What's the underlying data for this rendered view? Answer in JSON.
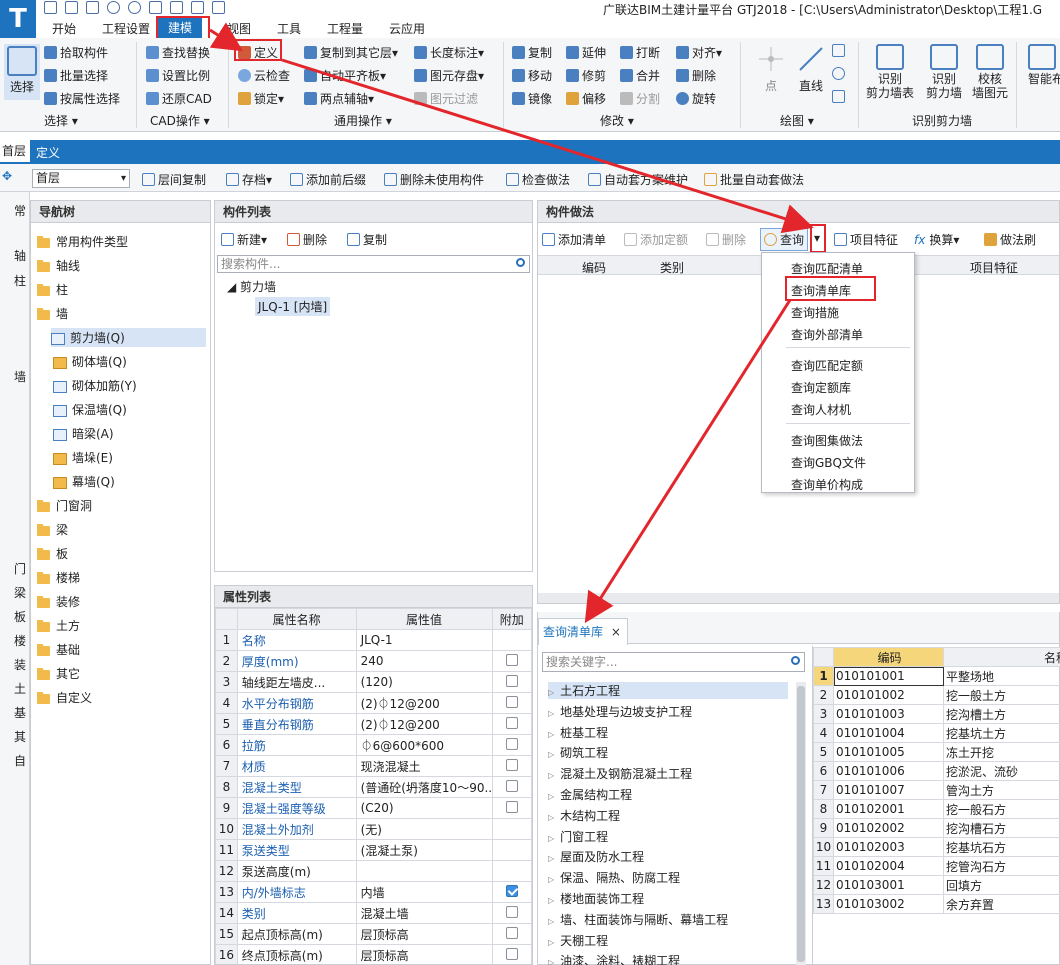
{
  "app": {
    "title": "广联达BIM土建计量平台 GTJ2018 - [C:\\Users\\Administrator\\Desktop\\工程1.G",
    "logo": "T"
  },
  "menu": [
    "开始",
    "工程设置",
    "建模",
    "视图",
    "工具",
    "工程量",
    "云应用"
  ],
  "ribbon": {
    "select_big": "选择",
    "select_items": [
      "拾取构件",
      "批量选择",
      "按属性选择"
    ],
    "select_group": "选择",
    "cad_items": [
      "查找替换",
      "设置比例",
      "还原CAD"
    ],
    "cad_group": "CAD操作",
    "define": "定义",
    "cloud_check": "云检查",
    "lock": "锁定",
    "common_items": [
      "复制到其它层",
      "自动平齐板",
      "两点辅轴"
    ],
    "common_items2": [
      "长度标注",
      "图元存盘",
      "图元过滤"
    ],
    "common_group": "通用操作",
    "modify_items": [
      "复制",
      "移动",
      "镜像",
      "延伸",
      "修剪",
      "偏移",
      "打断",
      "合并",
      "分割",
      "对齐",
      "删除",
      "旋转"
    ],
    "modify_group": "修改",
    "draw_items": [
      "点",
      "直线"
    ],
    "draw_group": "绘图",
    "recog_items": [
      "识别\n剪力墙表",
      "识别\n剪力墙",
      "校核\n墙图元",
      "智能布"
    ],
    "recog_group": "识别剪力墙"
  },
  "tabs": {
    "floor": "首层",
    "define": "定义"
  },
  "toolbar2": {
    "floor_select": "首层",
    "items": [
      "层间复制",
      "存档",
      "添加前后缀",
      "删除未使用构件",
      "检查做法",
      "自动套方案维护",
      "批量自动套做法"
    ]
  },
  "leftstrip": [
    "常",
    "轴",
    "柱",
    "墙",
    "门",
    "梁",
    "板",
    "楼",
    "装",
    "土",
    "基",
    "其",
    "自"
  ],
  "nav": {
    "title": "导航树",
    "items": [
      "常用构件类型",
      "轴线",
      "柱",
      "墙",
      "剪力墙(Q)",
      "砌体墙(Q)",
      "砌体加筋(Y)",
      "保温墙(Q)",
      "暗梁(A)",
      "墙垛(E)",
      "幕墙(Q)",
      "门窗洞",
      "梁",
      "板",
      "楼梯",
      "装修",
      "土方",
      "基础",
      "其它",
      "自定义"
    ]
  },
  "complist": {
    "title": "构件列表",
    "new": "新建",
    "delete": "删除",
    "copy": "复制",
    "search_placeholder": "搜索构件...",
    "group": "剪力墙",
    "item": "JLQ-1 [内墙]"
  },
  "props": {
    "title": "属性列表",
    "headers": [
      "属性名称",
      "属性值",
      "附加"
    ],
    "rows": [
      {
        "n": "1",
        "name": "名称",
        "value": "JLQ-1",
        "blue": true,
        "chk": null
      },
      {
        "n": "2",
        "name": "厚度(mm)",
        "value": "240",
        "blue": true,
        "chk": false
      },
      {
        "n": "3",
        "name": "轴线距左墙皮...",
        "value": "(120)",
        "blue": false,
        "chk": false
      },
      {
        "n": "4",
        "name": "水平分布钢筋",
        "value": "(2)⏀12@200",
        "blue": true,
        "chk": false
      },
      {
        "n": "5",
        "name": "垂直分布钢筋",
        "value": "(2)⏀12@200",
        "blue": true,
        "chk": false
      },
      {
        "n": "6",
        "name": "拉筋",
        "value": "⏀6@600*600",
        "blue": true,
        "chk": false
      },
      {
        "n": "7",
        "name": "材质",
        "value": "现浇混凝土",
        "blue": true,
        "chk": false
      },
      {
        "n": "8",
        "name": "混凝土类型",
        "value": "(普通砼(坍落度10～90...",
        "blue": true,
        "chk": false
      },
      {
        "n": "9",
        "name": "混凝土强度等级",
        "value": "(C20)",
        "blue": true,
        "chk": false
      },
      {
        "n": "10",
        "name": "混凝土外加剂",
        "value": "(无)",
        "blue": true,
        "chk": null
      },
      {
        "n": "11",
        "name": "泵送类型",
        "value": "(混凝土泵)",
        "blue": true,
        "chk": null
      },
      {
        "n": "12",
        "name": "泵送高度(m)",
        "value": "",
        "blue": false,
        "chk": null
      },
      {
        "n": "13",
        "name": "内/外墙标志",
        "value": "内墙",
        "blue": true,
        "chk": true
      },
      {
        "n": "14",
        "name": "类别",
        "value": "混凝土墙",
        "blue": true,
        "chk": false
      },
      {
        "n": "15",
        "name": "起点顶标高(m)",
        "value": "层顶标高",
        "blue": false,
        "chk": false
      },
      {
        "n": "16",
        "name": "终点顶标高(m)",
        "value": "层顶标高",
        "blue": false,
        "chk": false
      }
    ]
  },
  "method": {
    "title": "构件做法",
    "add_list": "添加清单",
    "add_quota": "添加定额",
    "delete": "删除",
    "query": "查询",
    "item_feature": "项目特征",
    "convert": "换算",
    "brush": "做法刷",
    "col_code": "编码",
    "col_type": "类别",
    "col_feature": "项目特征"
  },
  "dropdown": [
    "查询匹配清单",
    "查询清单库",
    "查询措施",
    "查询外部清单",
    "查询匹配定额",
    "查询定额库",
    "查询人材机",
    "查询图集做法",
    "查询GBQ文件",
    "查询单价构成"
  ],
  "query": {
    "tab": "查询清单库",
    "close": "×",
    "search_placeholder": "搜索关键字...",
    "categories": [
      "土石方工程",
      "地基处理与边坡支护工程",
      "桩基工程",
      "砌筑工程",
      "混凝土及钢筋混凝土工程",
      "金属结构工程",
      "木结构工程",
      "门窗工程",
      "屋面及防水工程",
      "保温、隔热、防腐工程",
      "楼地面装饰工程",
      "墙、柱面装饰与隔断、幕墙工程",
      "天棚工程",
      "油漆、涂料、裱糊工程"
    ],
    "col_code": "编码",
    "col_name": "名称",
    "rows": [
      [
        "1",
        "010101001",
        "平整场地"
      ],
      [
        "2",
        "010101002",
        "挖一般土方"
      ],
      [
        "3",
        "010101003",
        "挖沟槽土方"
      ],
      [
        "4",
        "010101004",
        "挖基坑土方"
      ],
      [
        "5",
        "010101005",
        "冻土开挖"
      ],
      [
        "6",
        "010101006",
        "挖淤泥、流砂"
      ],
      [
        "7",
        "010101007",
        "管沟土方"
      ],
      [
        "8",
        "010102001",
        "挖一般石方"
      ],
      [
        "9",
        "010102002",
        "挖沟槽石方"
      ],
      [
        "10",
        "010102003",
        "挖基坑石方"
      ],
      [
        "11",
        "010102004",
        "挖管沟石方"
      ],
      [
        "12",
        "010103001",
        "回填方"
      ],
      [
        "13",
        "010103002",
        "余方弃置"
      ]
    ]
  },
  "colors": {
    "accent": "#1e73be",
    "highlight": "#e3262b"
  }
}
